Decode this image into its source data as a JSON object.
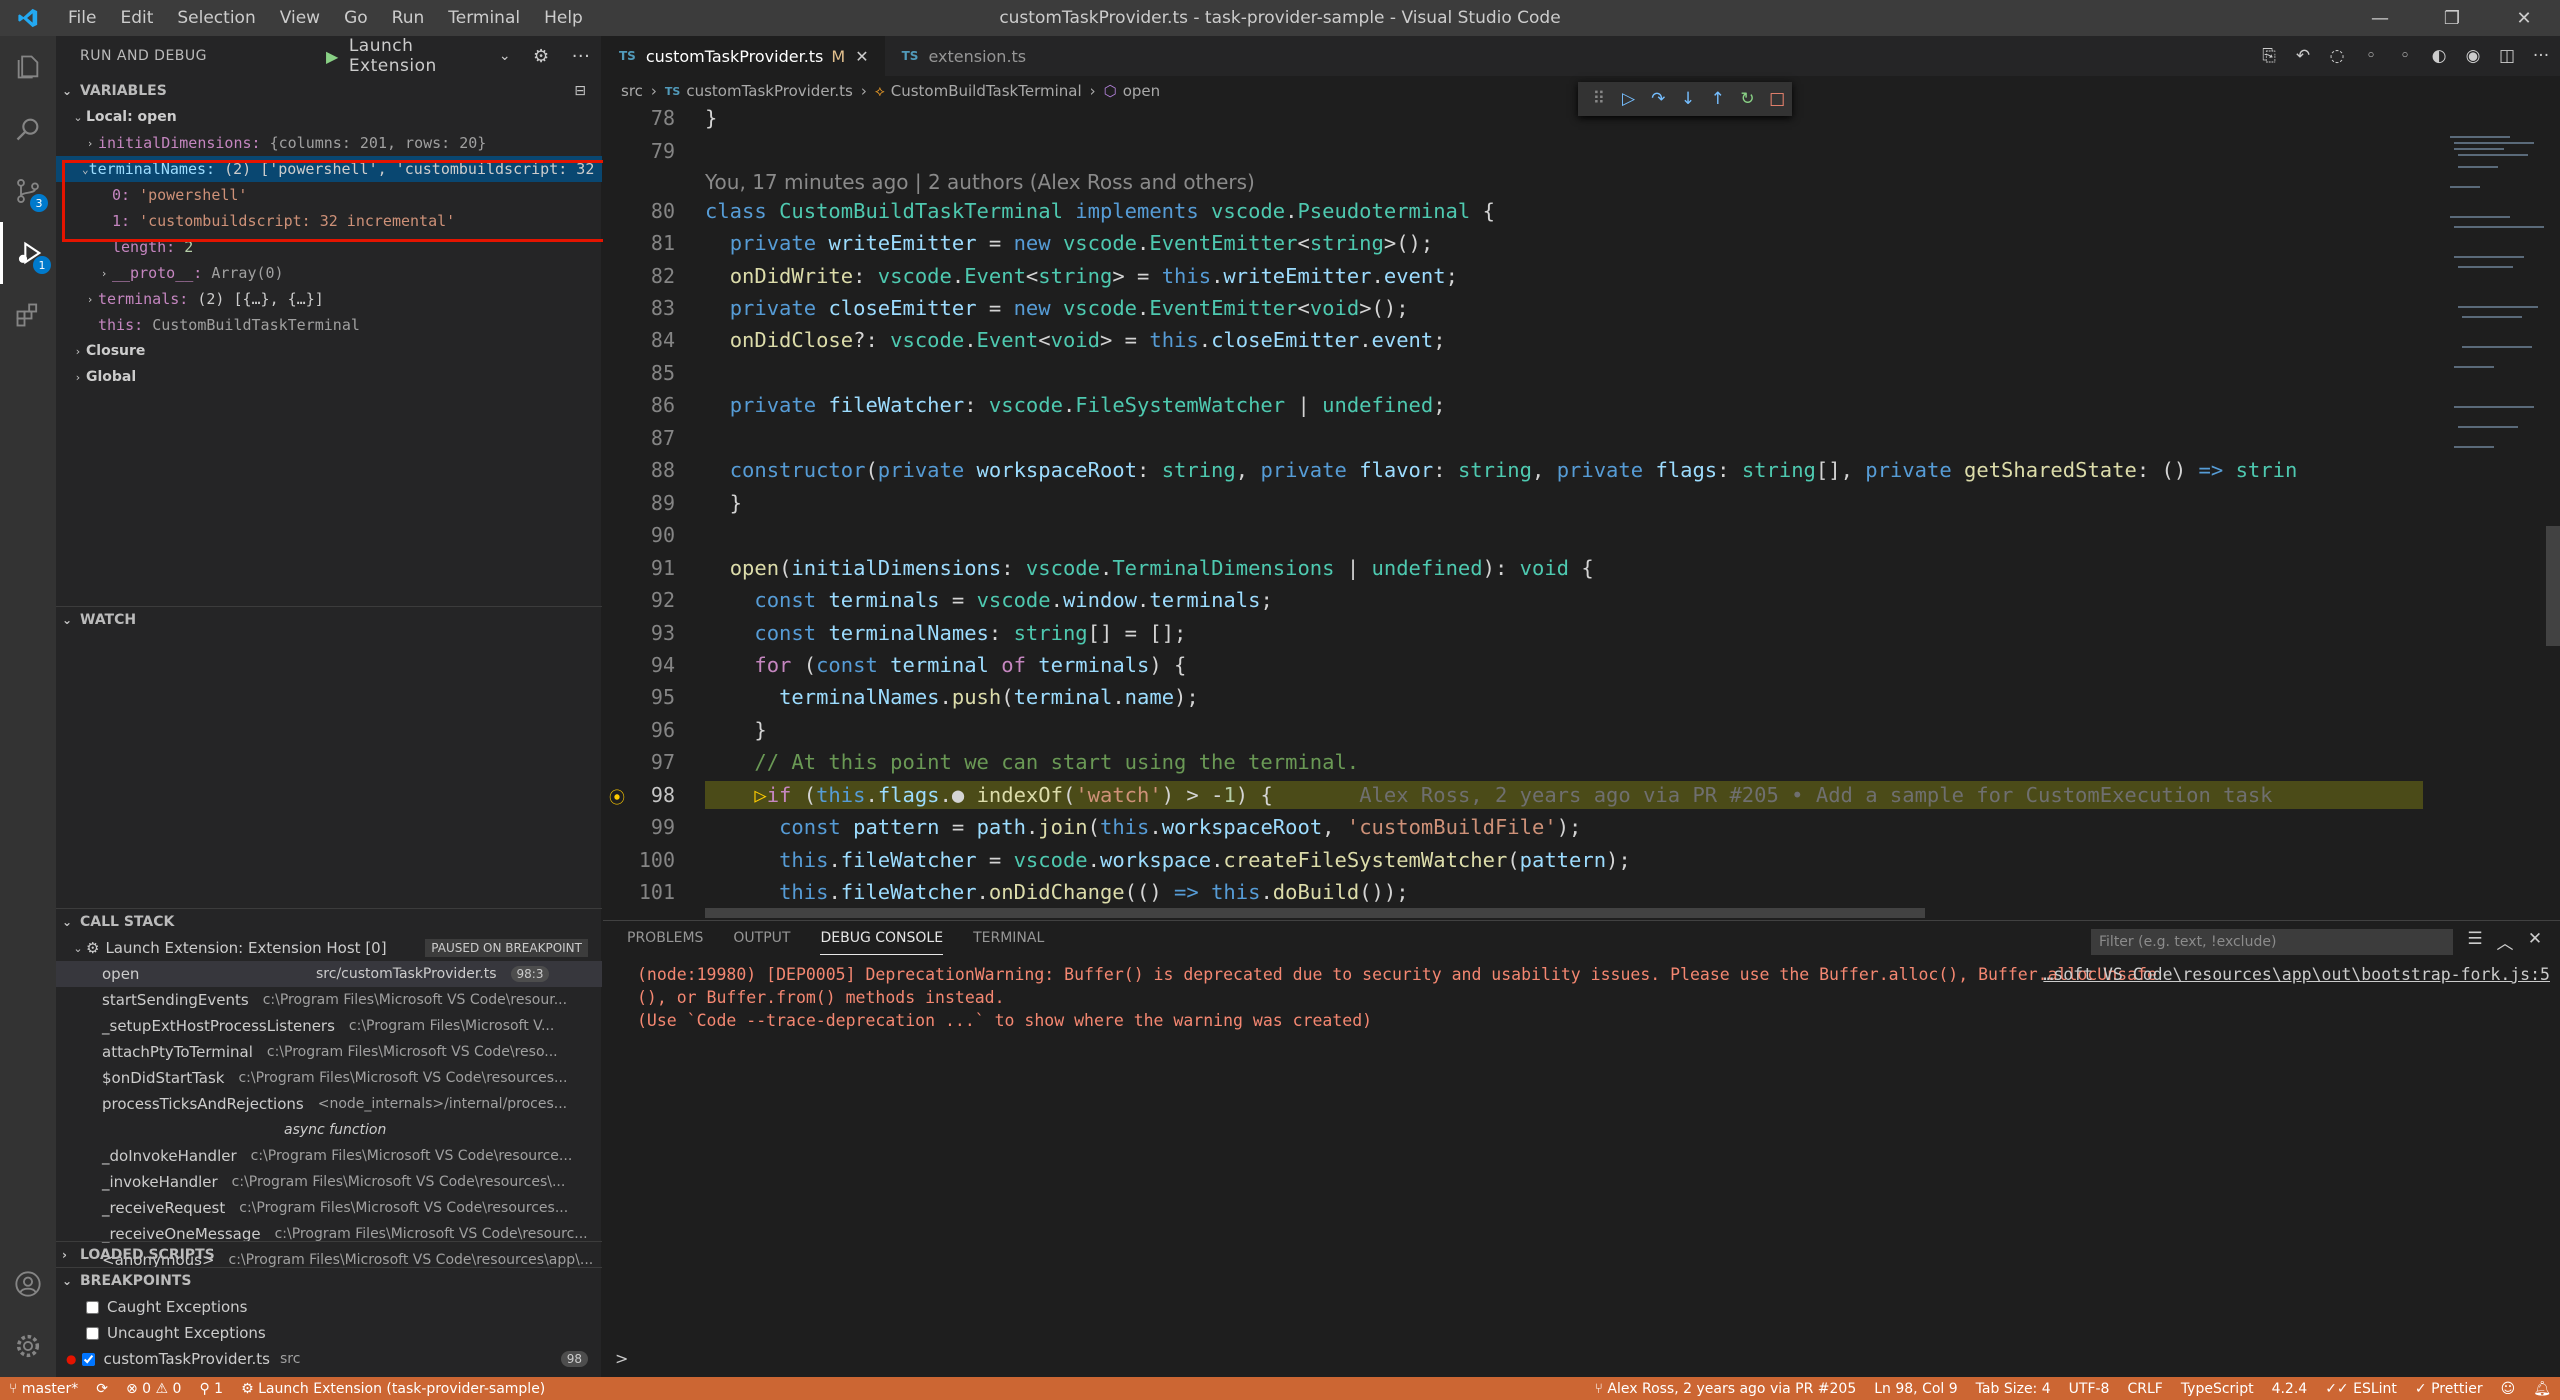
{
  "window": {
    "title": "customTaskProvider.ts - task-provider-sample - Visual Studio Code",
    "menu": [
      "File",
      "Edit",
      "Selection",
      "View",
      "Go",
      "Run",
      "Terminal",
      "Help"
    ]
  },
  "activity_bar": {
    "badges": {
      "scm": "3",
      "debug": "1"
    }
  },
  "sidebar": {
    "header": "RUN AND DEBUG",
    "launch_config": "Launch Extension",
    "variables": {
      "title": "VARIABLES",
      "scope_local": "Local: open",
      "rows": [
        {
          "name": "initialDimensions:",
          "value": "{columns: 201, rows: 20}"
        },
        {
          "name": "terminalNames:",
          "value": "(2) ['powershell', 'custombuildscript: 32 …"
        },
        {
          "name": "0:",
          "value": "'powershell'"
        },
        {
          "name": "1:",
          "value": "'custombuildscript: 32 incremental'"
        },
        {
          "name": "length:",
          "value": "2"
        },
        {
          "name": "__proto__:",
          "value": "Array(0)"
        },
        {
          "name": "terminals:",
          "value": "(2) [{…}, {…}]"
        },
        {
          "name": "this:",
          "value": "CustomBuildTaskTerminal"
        }
      ],
      "scope_closure": "Closure",
      "scope_global": "Global"
    },
    "watch": {
      "title": "WATCH"
    },
    "call_stack": {
      "title": "CALL STACK",
      "thread": "Launch Extension: Extension Host [0]",
      "thread_status": "PAUSED ON BREAKPOINT",
      "frames": [
        {
          "fn": "open",
          "src": "src/customTaskProvider.ts",
          "pos": "98:3"
        },
        {
          "fn": "startSendingEvents",
          "src": "c:\\Program Files\\Microsoft VS Code\\resour..."
        },
        {
          "fn": "_setupExtHostProcessListeners",
          "src": "c:\\Program Files\\Microsoft V..."
        },
        {
          "fn": "attachPtyToTerminal",
          "src": "c:\\Program Files\\Microsoft VS Code\\reso..."
        },
        {
          "fn": "$onDidStartTask",
          "src": "c:\\Program Files\\Microsoft VS Code\\resources..."
        },
        {
          "fn": "processTicksAndRejections",
          "src": "<node_internals>/internal/proces..."
        },
        {
          "fn": "",
          "src": "async function"
        },
        {
          "fn": "_doInvokeHandler",
          "src": "c:\\Program Files\\Microsoft VS Code\\resource..."
        },
        {
          "fn": "_invokeHandler",
          "src": "c:\\Program Files\\Microsoft VS Code\\resources\\..."
        },
        {
          "fn": "_receiveRequest",
          "src": "c:\\Program Files\\Microsoft VS Code\\resources..."
        },
        {
          "fn": "_receiveOneMessage",
          "src": "c:\\Program Files\\Microsoft VS Code\\resourc..."
        },
        {
          "fn": "<anonymous>",
          "src": "c:\\Program Files\\Microsoft VS Code\\resources\\app\\..."
        }
      ]
    },
    "loaded_scripts": {
      "title": "LOADED SCRIPTS"
    },
    "breakpoints": {
      "title": "BREAKPOINTS",
      "items": [
        {
          "label": "Caught Exceptions",
          "path": "",
          "line": ""
        },
        {
          "label": "Uncaught Exceptions",
          "path": "",
          "line": ""
        },
        {
          "label": "customTaskProvider.ts",
          "path": "src",
          "line": "98"
        }
      ]
    }
  },
  "editor": {
    "tabs": [
      {
        "label": "customTaskProvider.ts",
        "modified": "M",
        "icon": "TS"
      },
      {
        "label": "extension.ts",
        "icon": "TS"
      }
    ],
    "breadcrumbs": [
      "src",
      "customTaskProvider.ts",
      "CustomBuildTaskTerminal",
      "open"
    ],
    "blame_header": "You, 17 minutes ago | 2 authors (Alex Ross and others)",
    "inline_blame": "Alex Ross, 2 years ago via PR #205 • Add a sample for CustomExecution task",
    "line_numbers": [
      "78",
      "79",
      "80",
      "81",
      "82",
      "83",
      "84",
      "85",
      "86",
      "87",
      "88",
      "89",
      "90",
      "91",
      "92",
      "93",
      "94",
      "95",
      "96",
      "97",
      "98",
      "99",
      "100",
      "101"
    ]
  },
  "panel": {
    "tabs": [
      "PROBLEMS",
      "OUTPUT",
      "DEBUG CONSOLE",
      "TERMINAL"
    ],
    "filter_placeholder": "Filter (e.g. text, !exclude)",
    "console": [
      "(node:19980) [DEP0005] DeprecationWarning: Buffer() is deprecated due to security and usability issues. Please use the Buffer.alloc(), Buffer.allocUnsafe",
      "(), or Buffer.from() methods instead.",
      "(Use `Code --trace-deprecation ...` to show where the warning was created)"
    ],
    "console_source": "…soft VS Code\\resources\\app\\out\\bootstrap-fork.js:5",
    "prompt": ">"
  },
  "status": {
    "branch": "master*",
    "sync": "",
    "errors": "0",
    "warnings": "0",
    "ports": "1",
    "debug": "Launch Extension (task-provider-sample)",
    "blame": "Alex Ross, 2 years ago via PR #205",
    "position": "Ln 98, Col 9",
    "tabsize": "Tab Size: 4",
    "encoding": "UTF-8",
    "eol": "CRLF",
    "language": "TypeScript",
    "version": "4.2.4",
    "eslint": "ESLint",
    "prettier": "Prettier",
    "color": "#cc6633"
  }
}
